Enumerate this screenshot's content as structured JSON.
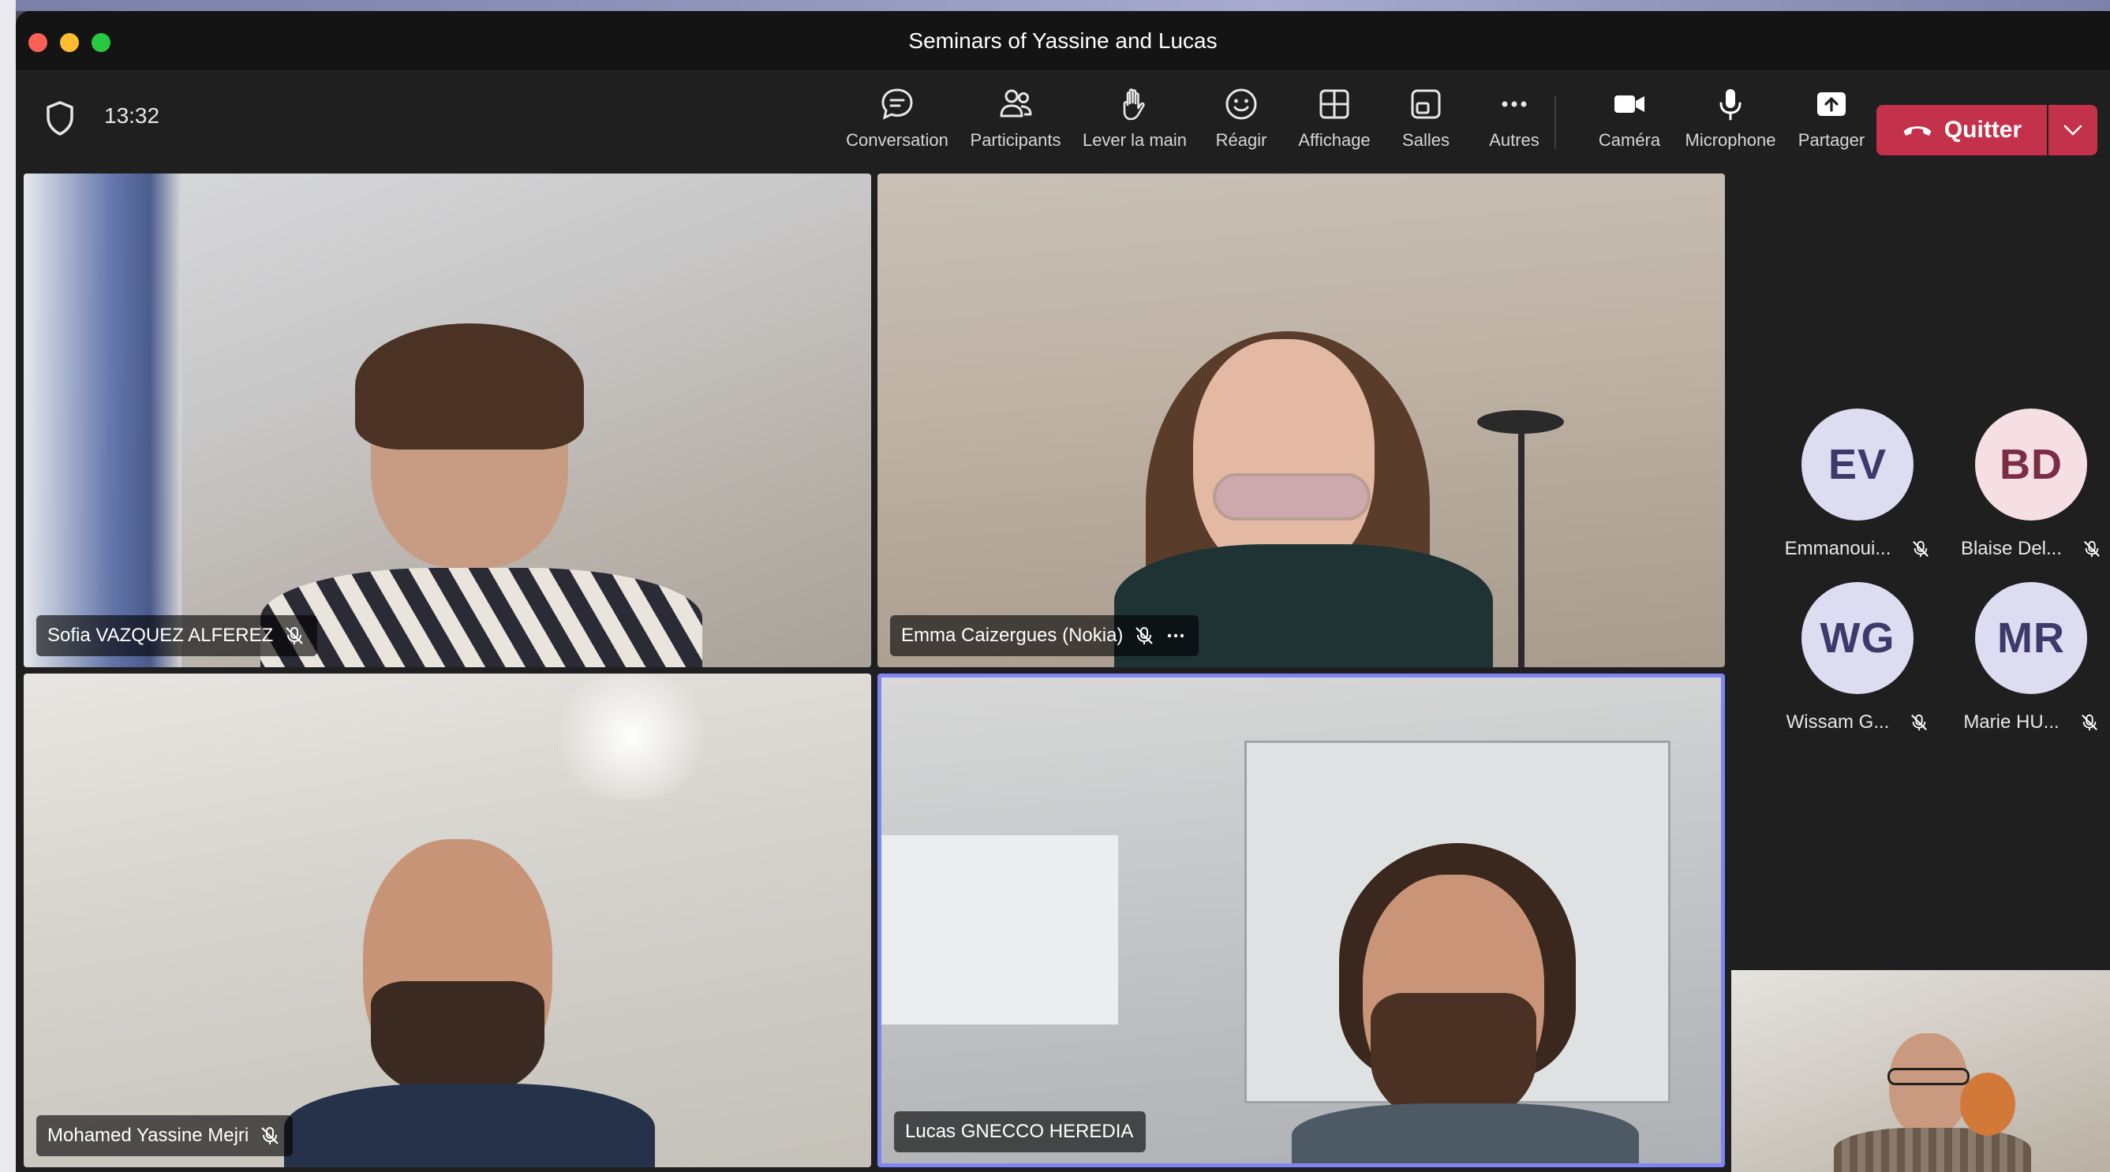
{
  "window": {
    "title": "Seminars of Yassine and Lucas"
  },
  "toolbar": {
    "time": "13:32",
    "items": [
      {
        "label": "Conversation",
        "icon": "chat-icon"
      },
      {
        "label": "Participants",
        "icon": "people-icon"
      },
      {
        "label": "Lever la main",
        "icon": "raise-hand-icon"
      },
      {
        "label": "Réagir",
        "icon": "smiley-icon"
      },
      {
        "label": "Affichage",
        "icon": "grid-icon"
      },
      {
        "label": "Salles",
        "icon": "breakout-rooms-icon"
      },
      {
        "label": "Autres",
        "icon": "more-icon"
      },
      {
        "label": "Caméra",
        "icon": "camera-icon"
      },
      {
        "label": "Microphone",
        "icon": "microphone-icon"
      },
      {
        "label": "Partager",
        "icon": "share-icon"
      }
    ],
    "leave_label": "Quitter"
  },
  "video_tiles": [
    {
      "name": "Sofia VAZQUEZ ALFEREZ",
      "muted": true
    },
    {
      "name": "Emma Caizergues (Nokia)",
      "muted": true
    },
    {
      "name": "Mohamed Yassine Mejri",
      "muted": true
    },
    {
      "name": "Lucas GNECCO HEREDIA",
      "muted": false,
      "active_speaker": true
    }
  ],
  "roster": [
    {
      "initials": "EV",
      "name": "Emmanoui...",
      "avatar_color": "#dedcf0",
      "muted": true
    },
    {
      "initials": "BD",
      "name": "Blaise Del...",
      "avatar_color": "#f5dfe4",
      "muted": true
    },
    {
      "initials": "WG",
      "name": "Wissam G...",
      "avatar_color": "#dedcf0",
      "muted": true
    },
    {
      "initials": "MR",
      "name": "Marie HU...",
      "avatar_color": "#dedcf0",
      "muted": true
    }
  ],
  "colors": {
    "leave": "#c4314b",
    "active_speaker_border": "#7f85f5"
  }
}
